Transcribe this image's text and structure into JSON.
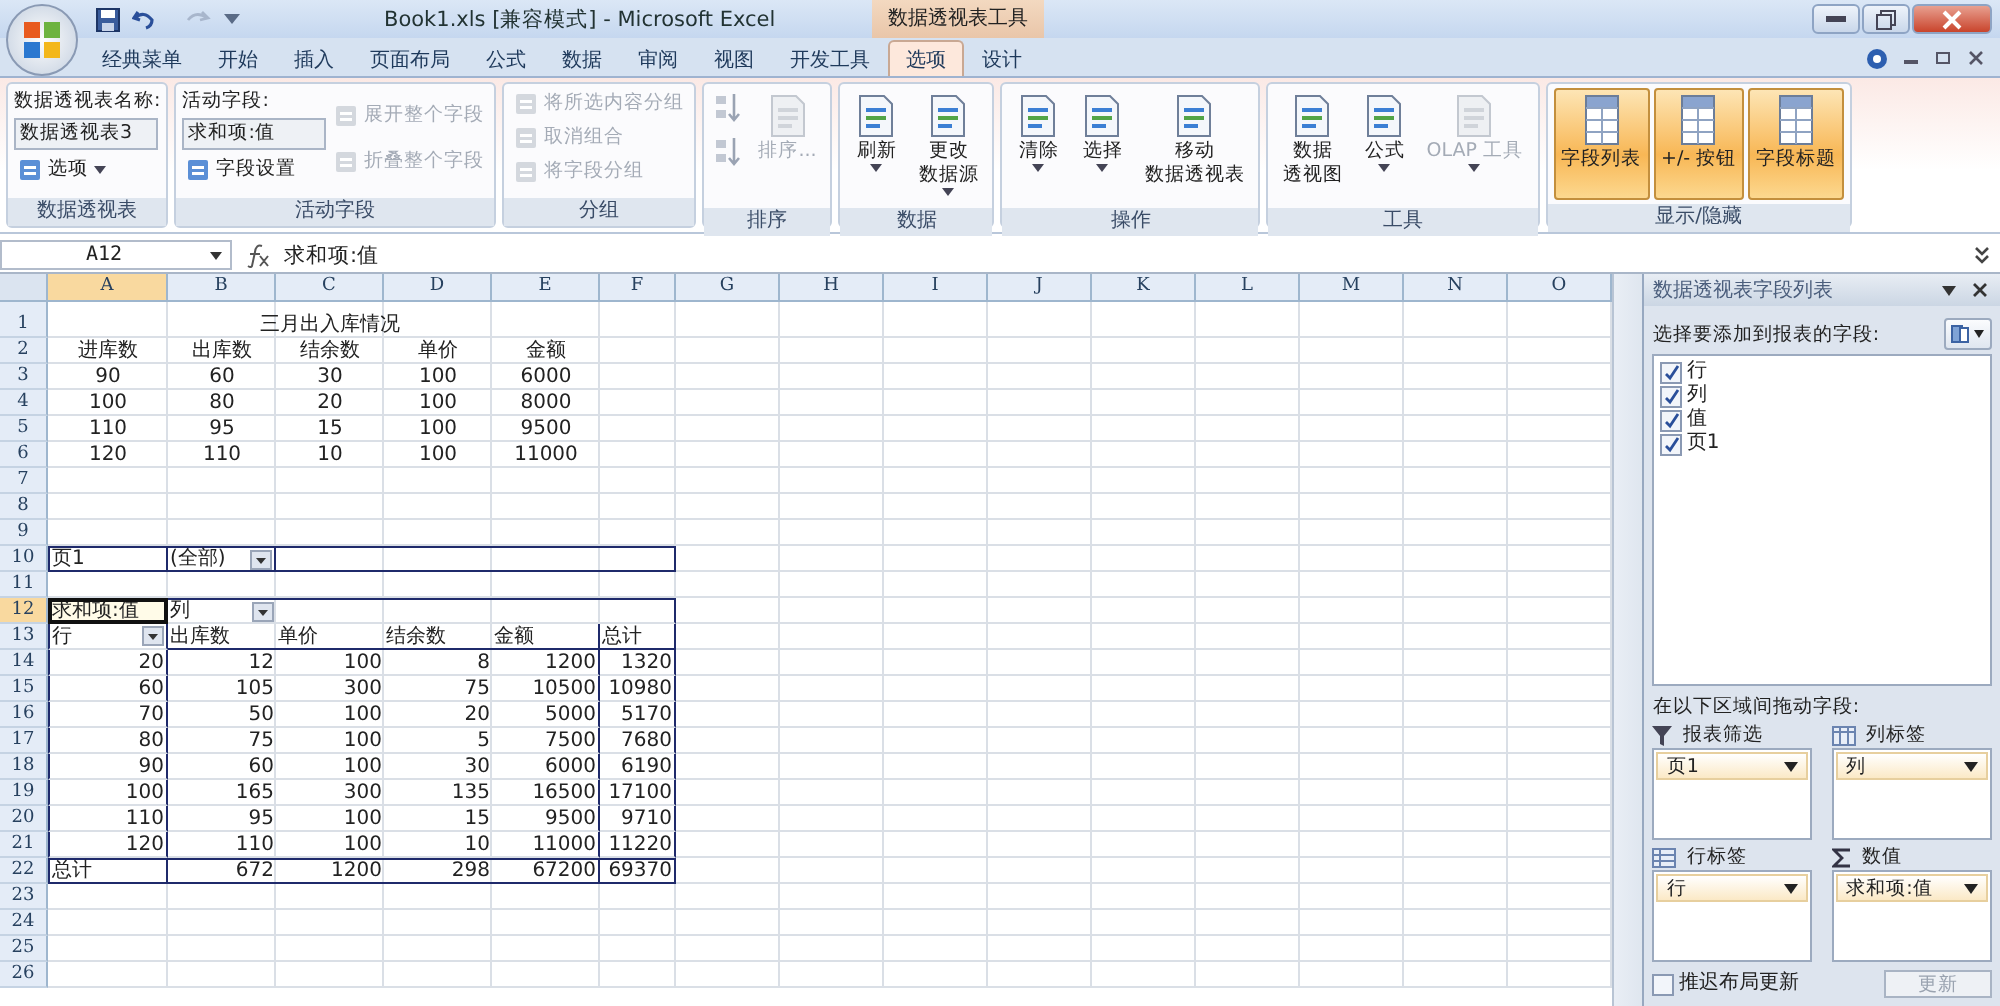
{
  "window": {
    "title": "Book1.xls  [兼容模式] - Microsoft Excel",
    "context_tab_group": "数据透视表工具"
  },
  "tabs": [
    {
      "label": "经典菜单",
      "selected": false
    },
    {
      "label": "开始",
      "selected": false
    },
    {
      "label": "插入",
      "selected": false
    },
    {
      "label": "页面布局",
      "selected": false
    },
    {
      "label": "公式",
      "selected": false
    },
    {
      "label": "数据",
      "selected": false
    },
    {
      "label": "审阅",
      "selected": false
    },
    {
      "label": "视图",
      "selected": false
    },
    {
      "label": "开发工具",
      "selected": false
    },
    {
      "label": "选项",
      "selected": true
    },
    {
      "label": "设计",
      "selected": false
    }
  ],
  "ribbon": {
    "groups": [
      {
        "title": "数据透视表",
        "columns": [
          [
            {
              "kind": "caption",
              "label": "数据透视表名称:"
            },
            {
              "kind": "field",
              "value": "数据透视表3"
            },
            {
              "kind": "small",
              "label": "选项",
              "dropdown": true,
              "disabled": false
            }
          ]
        ]
      },
      {
        "title": "活动字段",
        "columns": [
          [
            {
              "kind": "caption",
              "label": "活动字段:"
            },
            {
              "kind": "field",
              "value": "求和项:值"
            },
            {
              "kind": "small",
              "label": "字段设置",
              "dropdown": false,
              "disabled": false
            }
          ],
          [
            {
              "kind": "small",
              "label": "展开整个字段",
              "dropdown": false,
              "disabled": true
            },
            {
              "kind": "small",
              "label": "折叠整个字段",
              "dropdown": false,
              "disabled": true
            }
          ]
        ]
      },
      {
        "title": "分组",
        "columns": [
          [
            {
              "kind": "small",
              "label": "将所选内容分组",
              "dropdown": false,
              "disabled": true
            },
            {
              "kind": "small",
              "label": "取消组合",
              "dropdown": false,
              "disabled": true
            },
            {
              "kind": "small",
              "label": "将字段分组",
              "dropdown": false,
              "disabled": true
            }
          ]
        ]
      },
      {
        "title": "排序",
        "columns": [
          [
            {
              "kind": "icon",
              "disabled": true
            },
            {
              "kind": "icon",
              "disabled": true
            }
          ],
          [
            {
              "kind": "large",
              "lines": [
                "排序..."
              ],
              "dropdown": false,
              "disabled": true
            }
          ]
        ]
      },
      {
        "title": "数据",
        "columns": [
          [
            {
              "kind": "large",
              "lines": [
                "刷新"
              ],
              "dropdown": true,
              "disabled": false
            }
          ],
          [
            {
              "kind": "large",
              "lines": [
                "更改",
                "数据源"
              ],
              "dropdown": true,
              "disabled": false
            }
          ]
        ]
      },
      {
        "title": "操作",
        "columns": [
          [
            {
              "kind": "large",
              "lines": [
                "清除"
              ],
              "dropdown": true,
              "disabled": false
            }
          ],
          [
            {
              "kind": "large",
              "lines": [
                "选择"
              ],
              "dropdown": true,
              "disabled": false
            }
          ],
          [
            {
              "kind": "large",
              "lines": [
                "移动",
                "数据透视表"
              ],
              "dropdown": false,
              "disabled": false
            }
          ]
        ]
      },
      {
        "title": "工具",
        "columns": [
          [
            {
              "kind": "large",
              "lines": [
                "数据",
                "透视图"
              ],
              "dropdown": false,
              "disabled": false
            }
          ],
          [
            {
              "kind": "large",
              "lines": [
                "公式"
              ],
              "dropdown": true,
              "disabled": false
            }
          ],
          [
            {
              "kind": "large",
              "lines": [
                "OLAP 工具"
              ],
              "dropdown": true,
              "disabled": true
            }
          ]
        ]
      },
      {
        "title": "显示/隐藏",
        "columns": [
          [
            {
              "kind": "toggle",
              "lines": [
                "字段列表"
              ],
              "on": true
            }
          ],
          [
            {
              "kind": "toggle",
              "lines": [
                "+/- 按钮"
              ],
              "on": true
            }
          ],
          [
            {
              "kind": "toggle",
              "lines": [
                "字段标题"
              ],
              "on": true
            }
          ]
        ]
      }
    ]
  },
  "formula_bar": {
    "name_box": "A12",
    "formula": "求和项:值"
  },
  "sheet": {
    "columns": [
      {
        "label": "A",
        "selected": true
      },
      {
        "label": "B",
        "selected": false
      },
      {
        "label": "C",
        "selected": false
      },
      {
        "label": "D",
        "selected": false
      },
      {
        "label": "E",
        "selected": false
      },
      {
        "label": "F",
        "selected": false
      },
      {
        "label": "G",
        "selected": false
      },
      {
        "label": "H",
        "selected": false
      },
      {
        "label": "I",
        "selected": false
      },
      {
        "label": "J",
        "selected": false
      },
      {
        "label": "K",
        "selected": false
      },
      {
        "label": "L",
        "selected": false
      },
      {
        "label": "M",
        "selected": false
      },
      {
        "label": "N",
        "selected": false
      },
      {
        "label": "O",
        "selected": false
      }
    ],
    "rows": [
      {
        "number": "1",
        "kind": "title",
        "selected": false,
        "cells": [
          "",
          "",
          "三月出入库情况"
        ]
      },
      {
        "number": "2",
        "kind": "table",
        "selected": false,
        "cells": [
          "进库数",
          "出库数",
          "结余数",
          "单价",
          "金额"
        ]
      },
      {
        "number": "3",
        "kind": "table",
        "selected": false,
        "cells": [
          "90",
          "60",
          "30",
          "100",
          "6000"
        ]
      },
      {
        "number": "4",
        "kind": "table",
        "selected": false,
        "cells": [
          "100",
          "80",
          "20",
          "100",
          "8000"
        ]
      },
      {
        "number": "5",
        "kind": "table",
        "selected": false,
        "cells": [
          "110",
          "95",
          "15",
          "100",
          "9500"
        ]
      },
      {
        "number": "6",
        "kind": "table",
        "selected": false,
        "cells": [
          "120",
          "110",
          "10",
          "100",
          "11000"
        ]
      },
      {
        "number": "7",
        "kind": "blank",
        "selected": false,
        "cells": []
      },
      {
        "number": "8",
        "kind": "blank",
        "selected": false,
        "cells": []
      },
      {
        "number": "9",
        "kind": "blank",
        "selected": false,
        "cells": []
      },
      {
        "number": "10",
        "kind": "filter",
        "selected": false,
        "cells": [
          "页1",
          "(全部)"
        ]
      },
      {
        "number": "11",
        "kind": "blank",
        "selected": false,
        "cells": []
      },
      {
        "number": "12",
        "kind": "pivot-head",
        "selected": true,
        "cells": [
          "求和项:值",
          "列"
        ]
      },
      {
        "number": "13",
        "kind": "pivot-cols",
        "selected": false,
        "cells": [
          "行",
          "出库数",
          "单价",
          "结余数",
          "金额",
          "总计"
        ]
      },
      {
        "number": "14",
        "kind": "pivot-data",
        "selected": false,
        "cells": [
          "20",
          "12",
          "100",
          "8",
          "1200",
          "1320"
        ]
      },
      {
        "number": "15",
        "kind": "pivot-data",
        "selected": false,
        "cells": [
          "60",
          "105",
          "300",
          "75",
          "10500",
          "10980"
        ]
      },
      {
        "number": "16",
        "kind": "pivot-data",
        "selected": false,
        "cells": [
          "70",
          "50",
          "100",
          "20",
          "5000",
          "5170"
        ]
      },
      {
        "number": "17",
        "kind": "pivot-data",
        "selected": false,
        "cells": [
          "80",
          "75",
          "100",
          "5",
          "7500",
          "7680"
        ]
      },
      {
        "number": "18",
        "kind": "pivot-data",
        "selected": false,
        "cells": [
          "90",
          "60",
          "100",
          "30",
          "6000",
          "6190"
        ]
      },
      {
        "number": "19",
        "kind": "pivot-data",
        "selected": false,
        "cells": [
          "100",
          "165",
          "300",
          "135",
          "16500",
          "17100"
        ]
      },
      {
        "number": "20",
        "kind": "pivot-data",
        "selected": false,
        "cells": [
          "110",
          "95",
          "100",
          "15",
          "9500",
          "9710"
        ]
      },
      {
        "number": "21",
        "kind": "pivot-data",
        "selected": false,
        "cells": [
          "120",
          "110",
          "100",
          "10",
          "11000",
          "11220"
        ]
      },
      {
        "number": "22",
        "kind": "pivot-total",
        "selected": false,
        "cells": [
          "总计",
          "672",
          "1200",
          "298",
          "67200",
          "69370"
        ]
      },
      {
        "number": "23",
        "kind": "blank",
        "selected": false,
        "cells": []
      },
      {
        "number": "24",
        "kind": "blank",
        "selected": false,
        "cells": []
      },
      {
        "number": "25",
        "kind": "blank",
        "selected": false,
        "cells": []
      },
      {
        "number": "26",
        "kind": "blank",
        "selected": false,
        "cells": []
      }
    ]
  },
  "field_list": {
    "title": "数据透视表字段列表",
    "prompt": "选择要添加到报表的字段:",
    "fields": [
      {
        "label": "行",
        "checked": true
      },
      {
        "label": "列",
        "checked": true
      },
      {
        "label": "值",
        "checked": true
      },
      {
        "label": "页1",
        "checked": true
      }
    ],
    "areas_prompt": "在以下区域间拖动字段:",
    "areas": [
      {
        "kind": "filter",
        "label": "报表筛选",
        "fields": [
          "页1"
        ]
      },
      {
        "kind": "columns",
        "label": "列标签",
        "fields": [
          "列"
        ]
      },
      {
        "kind": "rows",
        "label": "行标签",
        "fields": [
          "行"
        ]
      },
      {
        "kind": "values",
        "label": "数值",
        "fields": [
          "求和项:值"
        ]
      }
    ],
    "defer_update": {
      "label": "推迟布局更新",
      "checked": false
    },
    "update_button": {
      "label": "更新",
      "disabled": true
    }
  }
}
